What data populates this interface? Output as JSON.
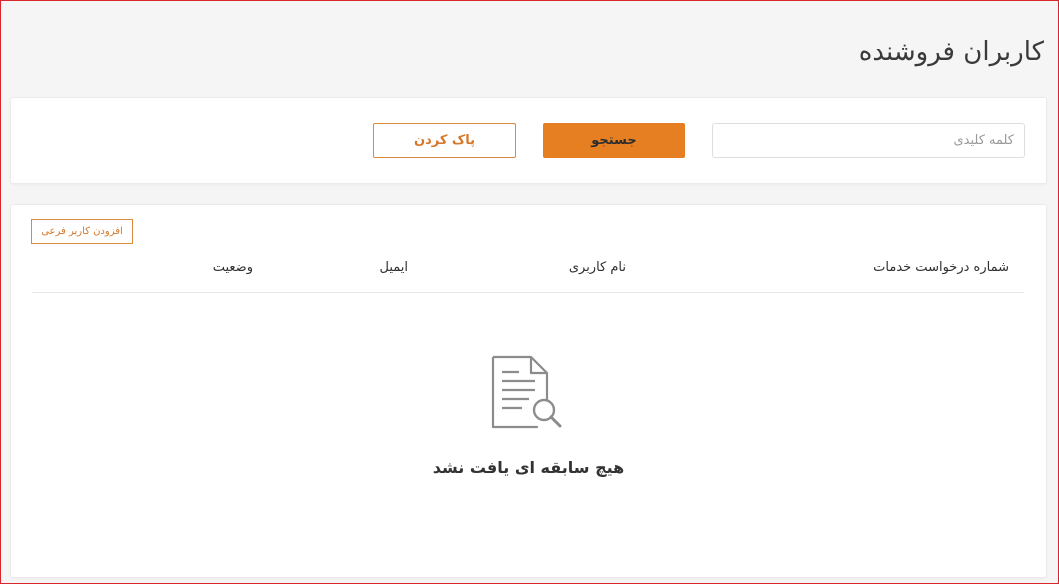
{
  "header": {
    "title": "کاربران فروشنده"
  },
  "search": {
    "placeholder": "کلمه کلیدی",
    "value": "",
    "search_label": "جستجو",
    "clear_label": "پاک کردن"
  },
  "list": {
    "add_label": "افزودن کاربر فرعی",
    "columns": {
      "service_request": "شماره درخواست خدمات",
      "username": "نام کاربری",
      "email": "ایمیل",
      "status": "وضعیت"
    },
    "empty_icon": "document-search-icon",
    "empty_text": "هیچ سابقه ای یافت نشد"
  },
  "colors": {
    "accent": "#e67e22",
    "page_background": "#f5f5f5",
    "frame_border": "#d9262c"
  }
}
